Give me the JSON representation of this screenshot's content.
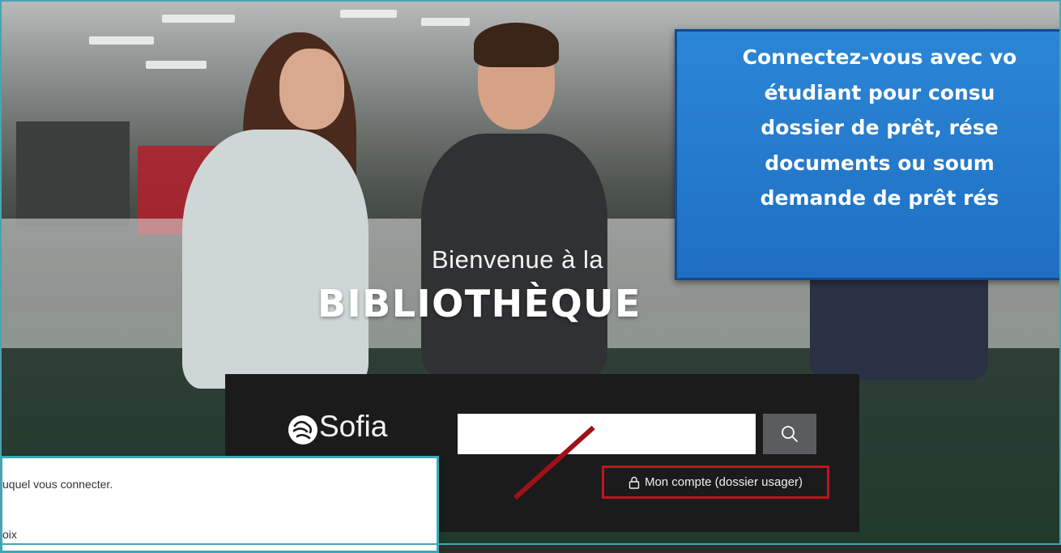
{
  "hero": {
    "welcome": "Bienvenue à la",
    "title": "BIBLIOTHÈQUE"
  },
  "callout": {
    "lines": [
      "Connectez-vous avec vo",
      "étudiant pour consu",
      "dossier de prêt, rése",
      "documents ou soum",
      "demande de prêt rés"
    ]
  },
  "search": {
    "logo_label": "Sofia",
    "logo_icon": "sofia-logo-icon",
    "input_value": "",
    "button_icon": "search-icon"
  },
  "account": {
    "icon": "lock-icon",
    "label": "Mon compte (dossier usager)"
  },
  "popup": {
    "line1": "uquel vous connecter.",
    "line2": "oix"
  },
  "colors": {
    "callout_bg": "#2281cf",
    "callout_border": "#0e4c91",
    "highlight_red": "#c0141d",
    "panel_bg": "#1b1b1c",
    "frame_teal": "#4aa3b1"
  }
}
